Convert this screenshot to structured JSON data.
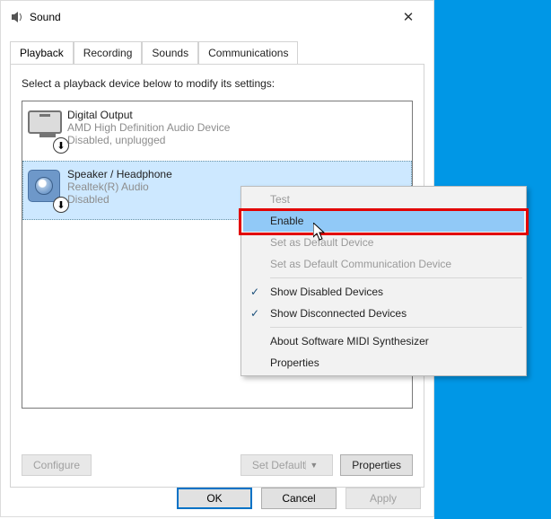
{
  "window": {
    "title": "Sound"
  },
  "tabs": {
    "items": [
      {
        "label": "Playback"
      },
      {
        "label": "Recording"
      },
      {
        "label": "Sounds"
      },
      {
        "label": "Communications"
      }
    ]
  },
  "instruction": "Select a playback device below to modify its settings:",
  "devices": [
    {
      "name": "Digital Output",
      "sub": "AMD High Definition Audio Device",
      "status": "Disabled, unplugged"
    },
    {
      "name": "Speaker / Headphone",
      "sub": "Realtek(R) Audio",
      "status": "Disabled"
    }
  ],
  "buttons": {
    "configure": "Configure",
    "setdefault": "Set Default",
    "properties": "Properties",
    "ok": "OK",
    "cancel": "Cancel",
    "apply": "Apply"
  },
  "context_menu": {
    "items": [
      {
        "label": "Test",
        "enabled": false
      },
      {
        "label": "Enable",
        "enabled": true,
        "highlight": true
      },
      {
        "label": "Set as Default Device",
        "enabled": false
      },
      {
        "label": "Set as Default Communication Device",
        "enabled": false
      },
      {
        "sep": true
      },
      {
        "label": "Show Disabled Devices",
        "enabled": true,
        "checked": true
      },
      {
        "label": "Show Disconnected Devices",
        "enabled": true,
        "checked": true
      },
      {
        "sep": true
      },
      {
        "label": "About Software MIDI Synthesizer",
        "enabled": true
      },
      {
        "label": "Properties",
        "enabled": true
      }
    ]
  }
}
